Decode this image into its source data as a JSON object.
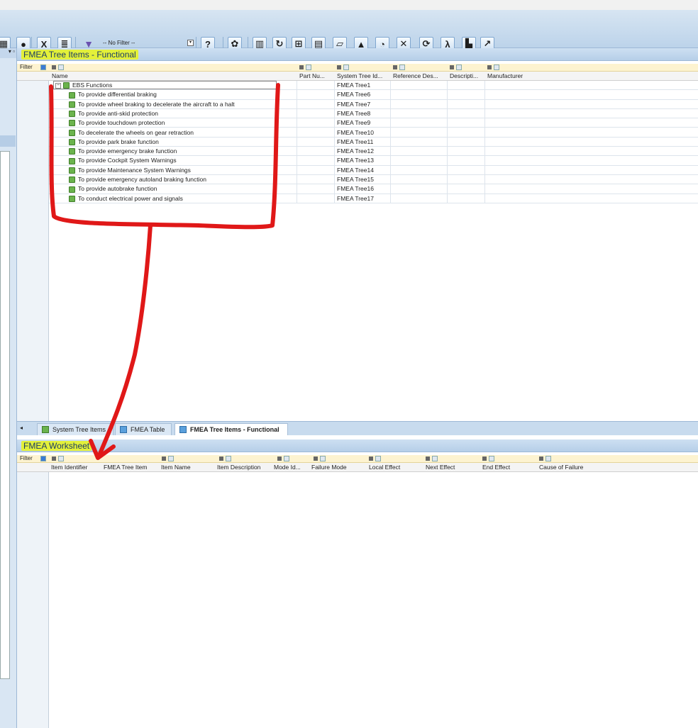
{
  "toolbar": {
    "filter_value": "-- No Filter --",
    "icons": [
      "calculator-icon",
      "globe-icon",
      "excel-icon",
      "report-icon",
      "filter-icon",
      "help-icon",
      "settings-icon",
      "columns-icon",
      "refresh-icon",
      "tree-icon",
      "table-icon",
      "folder-icon",
      "up-arrow-icon",
      "chart-icon",
      "tools-icon",
      "sync-icon",
      "lambda-icon",
      "export-icon",
      "graph-icon"
    ]
  },
  "top_pane": {
    "title": "FMEA Tree Items - Functional",
    "filter_label": "Filter",
    "columns": [
      "Name",
      "Part Nu...",
      "System Tree Id...",
      "Reference Des...",
      "Descripti...",
      "Manufacturer"
    ],
    "root": {
      "name": "EBS Functions",
      "tree_id": "FMEA Tree1"
    },
    "rows": [
      {
        "name": "To provide differential braking",
        "tree_id": "FMEA Tree6"
      },
      {
        "name": "To provide wheel braking to decelerate the aircraft to a halt",
        "tree_id": "FMEA Tree7"
      },
      {
        "name": "To provide anti-skid protection",
        "tree_id": "FMEA Tree8"
      },
      {
        "name": "To provide touchdown protection",
        "tree_id": "FMEA Tree9"
      },
      {
        "name": "To decelerate the wheels on gear retraction",
        "tree_id": "FMEA Tree10"
      },
      {
        "name": "To provide park brake function",
        "tree_id": "FMEA Tree11"
      },
      {
        "name": "To provide emergency brake function",
        "tree_id": "FMEA Tree12"
      },
      {
        "name": "To provide Cockpit System Warnings",
        "tree_id": "FMEA Tree13"
      },
      {
        "name": "To provide Maintenance System Warnings",
        "tree_id": "FMEA Tree14"
      },
      {
        "name": "To provide emergency autoland braking function",
        "tree_id": "FMEA Tree15"
      },
      {
        "name": "To provide autobrake function",
        "tree_id": "FMEA Tree16"
      },
      {
        "name": "To conduct electrical power and signals",
        "tree_id": "FMEA Tree17"
      }
    ]
  },
  "tabs": [
    {
      "label": "System Tree Items"
    },
    {
      "label": "FMEA Table"
    },
    {
      "label": "FMEA Tree Items - Functional",
      "active": true
    }
  ],
  "bottom_pane": {
    "title": "FMEA Worksheet",
    "filter_label": "Filter",
    "columns": [
      "Item Identifier",
      "FMEA Tree Item",
      "Item Name",
      "Item Description",
      "Mode Id...",
      "Failure Mode",
      "Local Effect",
      "Next Effect",
      "End Effect",
      "Cause of Failure"
    ]
  },
  "colors": {
    "highlight": "#e3f03a",
    "annotation": "#e01818",
    "title_text": "#1b3c66"
  }
}
